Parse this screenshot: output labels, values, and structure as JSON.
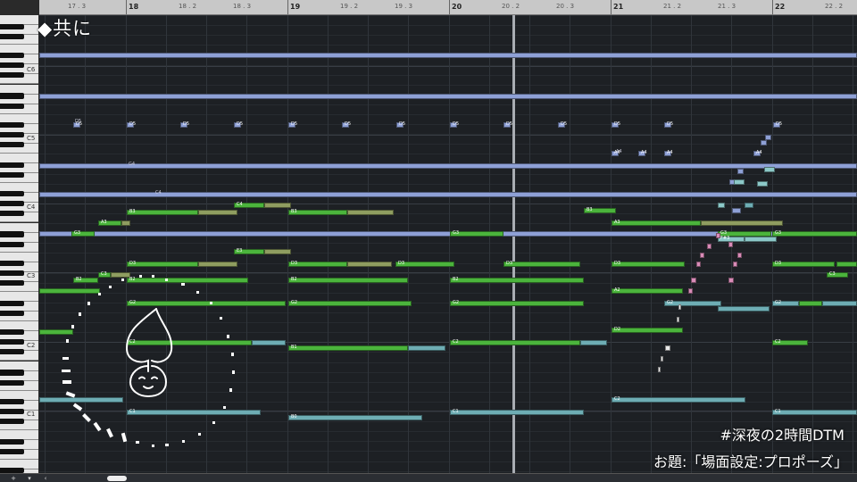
{
  "overlay": {
    "title": "◆共に",
    "hashtag": "#深夜の2時間DTM",
    "theme": "お題:「場面設定:プロポーズ」"
  },
  "keyboard": {
    "octave_labels": [
      "C6",
      "C5",
      "C4",
      "C3",
      "C2",
      "C1"
    ]
  },
  "ruler": {
    "bars": [
      "18",
      "19",
      "20",
      "21",
      "22"
    ],
    "subdivisions": [
      "17 . 3",
      "18 . 2",
      "18 . 3",
      "19 . 2",
      "19 . 3",
      "20 . 2",
      "20 . 3",
      "21 . 2",
      "21 . 3",
      "22 . 2"
    ]
  },
  "notes": {
    "labels": [
      "B3",
      "C4",
      "A3",
      "G3",
      "E3",
      "D3",
      "C3",
      "B2",
      "G2",
      "C2",
      "B1",
      "C1",
      "B0",
      "D2",
      "A2",
      "G3",
      "F#3",
      "D5",
      "G4",
      "C4",
      "A4"
    ]
  },
  "bottombar": {
    "add_label": "+",
    "menu_label": "▾",
    "scroll_left_label": "‹"
  },
  "colors": {
    "note_green": "#4bb43c",
    "note_olive": "#8f9d60",
    "note_teal": "#6eadb4",
    "note_blue": "#8ea0d6",
    "note_pink": "#d98cb8",
    "background": "#1e2125"
  }
}
